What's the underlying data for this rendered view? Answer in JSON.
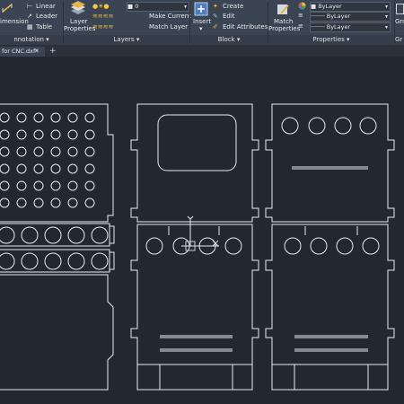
{
  "ribbon": {
    "annotation": {
      "dimension_label": "imension",
      "linear_label": "Linear",
      "leader_label": "Leader",
      "table_label": "Table",
      "panel_title": "nnotation"
    },
    "layers": {
      "layer_properties_label_1": "Layer",
      "layer_properties_label_2": "Properties",
      "current_layer_value": "0",
      "make_current_label": "Make Current",
      "match_layer_label": "Match Layer",
      "panel_title": "Layers"
    },
    "block": {
      "insert_label": "Insert",
      "create_label": "Create",
      "edit_label": "Edit",
      "edit_attributes_label": "Edit Attributes",
      "panel_title": "Block"
    },
    "properties": {
      "match_label_1": "Match",
      "match_label_2": "Properties",
      "color_value": "ByLayer",
      "lineweight_value": "ByLayer",
      "linetype_value": "ByLayer",
      "panel_title": "Properties"
    },
    "groups": {
      "group_label": "Gro",
      "panel_title": "Gr"
    }
  },
  "tabs": [
    {
      "label": "for CNC.dxf*"
    }
  ],
  "colors": {
    "background": "#212830",
    "ribbon": "#3b4453",
    "linework": "#e8ecef"
  },
  "icons": [
    "layer-properties-icon",
    "insert-block-icon",
    "match-properties-icon",
    "color-wheel-icon",
    "ucs-icon"
  ]
}
